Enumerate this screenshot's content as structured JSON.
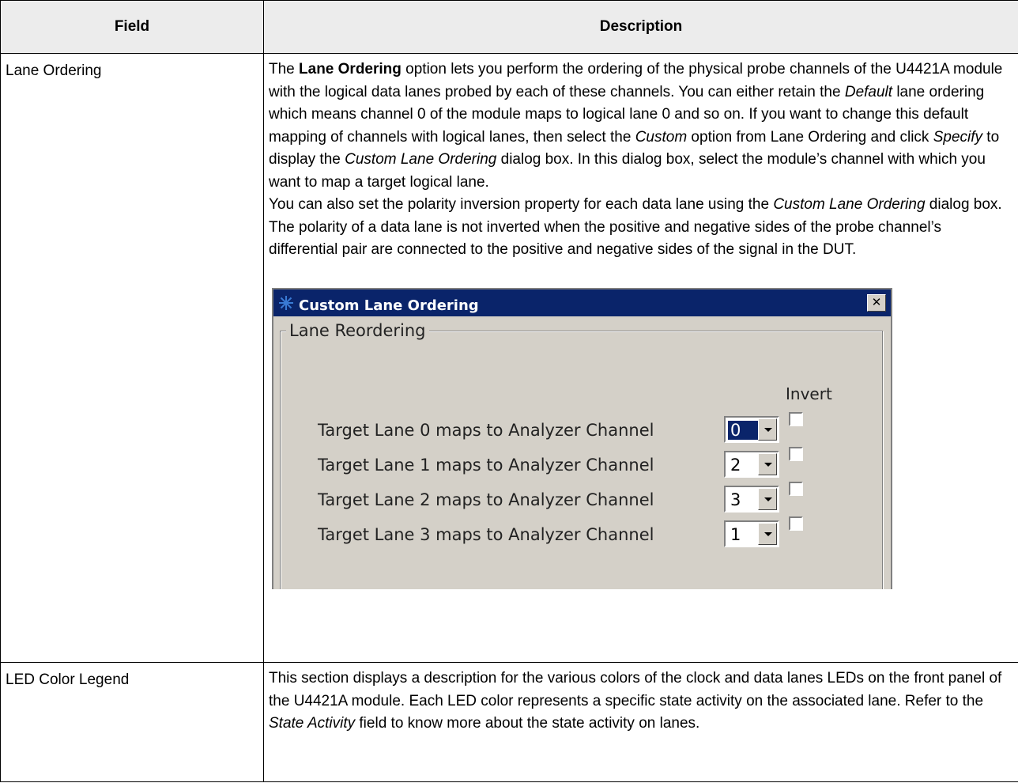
{
  "header": {
    "col_field": "Field",
    "col_description": "Description"
  },
  "row1": {
    "field": "Lane Ordering",
    "p1": [
      {
        "t": "The ",
        "s": "n"
      },
      {
        "t": "Lane Ordering",
        "s": "b"
      },
      {
        "t": " option lets you perform the ordering of the physical probe channels of the U4421A module with the logical data lanes probed by each of these channels. You can either retain the ",
        "s": "n"
      },
      {
        "t": "Default",
        "s": "i"
      },
      {
        "t": " lane ordering which means channel 0 of the module maps to logical lane 0 and so on. If you want to change this default mapping of channels with logical lanes, then select the ",
        "s": "n"
      },
      {
        "t": "Custom",
        "s": "i"
      },
      {
        "t": " option from Lane Ordering and click ",
        "s": "n"
      },
      {
        "t": "Specify",
        "s": "i"
      },
      {
        "t": " to display the ",
        "s": "n"
      },
      {
        "t": "Custom Lane Ordering",
        "s": "i"
      },
      {
        "t": " dialog box. In this dialog box, select the module’s channel with which you want to map a target logical lane.",
        "s": "n"
      }
    ],
    "p2": [
      {
        "t": "You can also set the polarity inversion property for each data lane using the ",
        "s": "n"
      },
      {
        "t": "Custom Lane Ordering",
        "s": "i"
      },
      {
        "t": " dialog box. The polarity of a data lane is not inverted when the positive and negative sides of the probe channel’s differential pair are connected to the positive and negative sides of the signal in the DUT.",
        "s": "n"
      }
    ]
  },
  "dialog": {
    "title": "Custom Lane Ordering",
    "close_glyph": "✕",
    "group_label": "Lane Reordering",
    "invert_label": "Invert",
    "lanes": [
      {
        "label": "Target Lane 0 maps to Analyzer Channel",
        "value": "0",
        "inverted": false
      },
      {
        "label": "Target Lane 1 maps to Analyzer Channel",
        "value": "2",
        "inverted": false
      },
      {
        "label": "Target Lane 2 maps to Analyzer Channel",
        "value": "3",
        "inverted": false
      },
      {
        "label": "Target Lane 3 maps to Analyzer Channel",
        "value": "1",
        "inverted": false
      }
    ]
  },
  "row2": {
    "field": "LED Color Legend",
    "p1": [
      {
        "t": "This section displays a description for the various colors of the clock and data lanes LEDs on the front panel of the U4421A module. Each LED color represents a specific state activity on the associated lane. Refer to the ",
        "s": "n"
      },
      {
        "t": "State Activity",
        "s": "i"
      },
      {
        "t": " field to know more about the state activity on lanes.",
        "s": "n"
      }
    ]
  }
}
